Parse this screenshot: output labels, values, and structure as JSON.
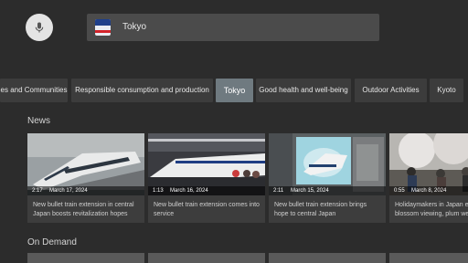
{
  "search": {
    "query": "Tokyo"
  },
  "topics": [
    {
      "label": "es and Communities",
      "selected": false
    },
    {
      "label": "Responsible consumption and production",
      "selected": false
    },
    {
      "label": "Tokyo",
      "selected": true
    },
    {
      "label": "Good health and well-being",
      "selected": false
    },
    {
      "label": "Outdoor Activities",
      "selected": false
    },
    {
      "label": "Kyoto",
      "selected": false
    }
  ],
  "sections": {
    "news": "News",
    "on_demand": "On Demand"
  },
  "news": [
    {
      "duration": "2:17",
      "date": "March 17, 2024",
      "title": "New bullet train extension in central Japan boosts revitalization hopes"
    },
    {
      "duration": "1:13",
      "date": "March 16, 2024",
      "title": "New bullet train extension comes into service"
    },
    {
      "duration": "2:11",
      "date": "March 15, 2024",
      "title": "New bullet train extension brings hope to central Japan"
    },
    {
      "duration": "0:55",
      "date": "March 8, 2024",
      "title": "Holidaymakers in Japan enjoy early blossom viewing, plum weather"
    }
  ]
}
